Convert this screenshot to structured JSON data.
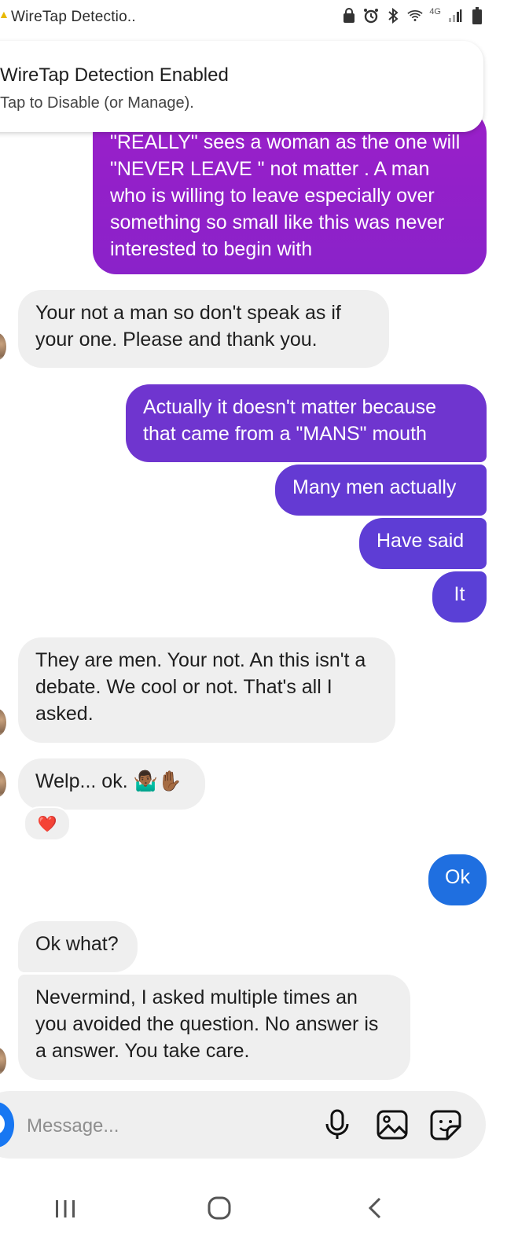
{
  "status_bar": {
    "app_title": "WireTap Detectio..",
    "network_label": "4G"
  },
  "notification": {
    "title": "WireTap Detection Enabled",
    "subtitle": "Tap to Disable (or Manage)."
  },
  "colors": {
    "outgoing_gradient_top": "#9a1fc9",
    "outgoing_gradient_bottom": "#5b3ed6",
    "outgoing_blue": "#1f6fe0",
    "incoming_bg": "#efefef",
    "accent": "#1877f2"
  },
  "messages": [
    {
      "side": "out",
      "text": "\"REALLY\" sees  a woman as the one will \"NEVER LEAVE \" not matter . A man who is willing to leave especially over something so small like this was never interested to begin with"
    },
    {
      "side": "in",
      "text": "Your not a man so don't speak as if your one. Please and thank you."
    },
    {
      "side": "out",
      "text": "Actually it doesn't matter because that came from a \"MANS\" mouth"
    },
    {
      "side": "out",
      "text": "Many men actually"
    },
    {
      "side": "out",
      "text": "Have said"
    },
    {
      "side": "out",
      "text": "It"
    },
    {
      "side": "in",
      "text": "They are men. Your not. An this isn't a debate. We cool or not. That's all I asked."
    },
    {
      "side": "in",
      "text": "Welp... ok. 🤷🏾‍♂️✋🏾",
      "reaction": "❤️"
    },
    {
      "side": "out",
      "text": "Ok"
    },
    {
      "side": "in",
      "text": "Ok what?"
    },
    {
      "side": "in",
      "text": "Nevermind, I asked multiple times an you avoided the question. No answer is a answer. You take care."
    }
  ],
  "composer": {
    "placeholder": "Message..."
  },
  "icons": [
    "warning-icon",
    "vpn-icon",
    "alarm-icon",
    "bluetooth-icon",
    "wifi-icon",
    "signal-icon",
    "battery-icon",
    "camera-icon",
    "microphone-icon",
    "gallery-icon",
    "sticker-icon",
    "recents-icon",
    "home-icon",
    "back-icon"
  ]
}
